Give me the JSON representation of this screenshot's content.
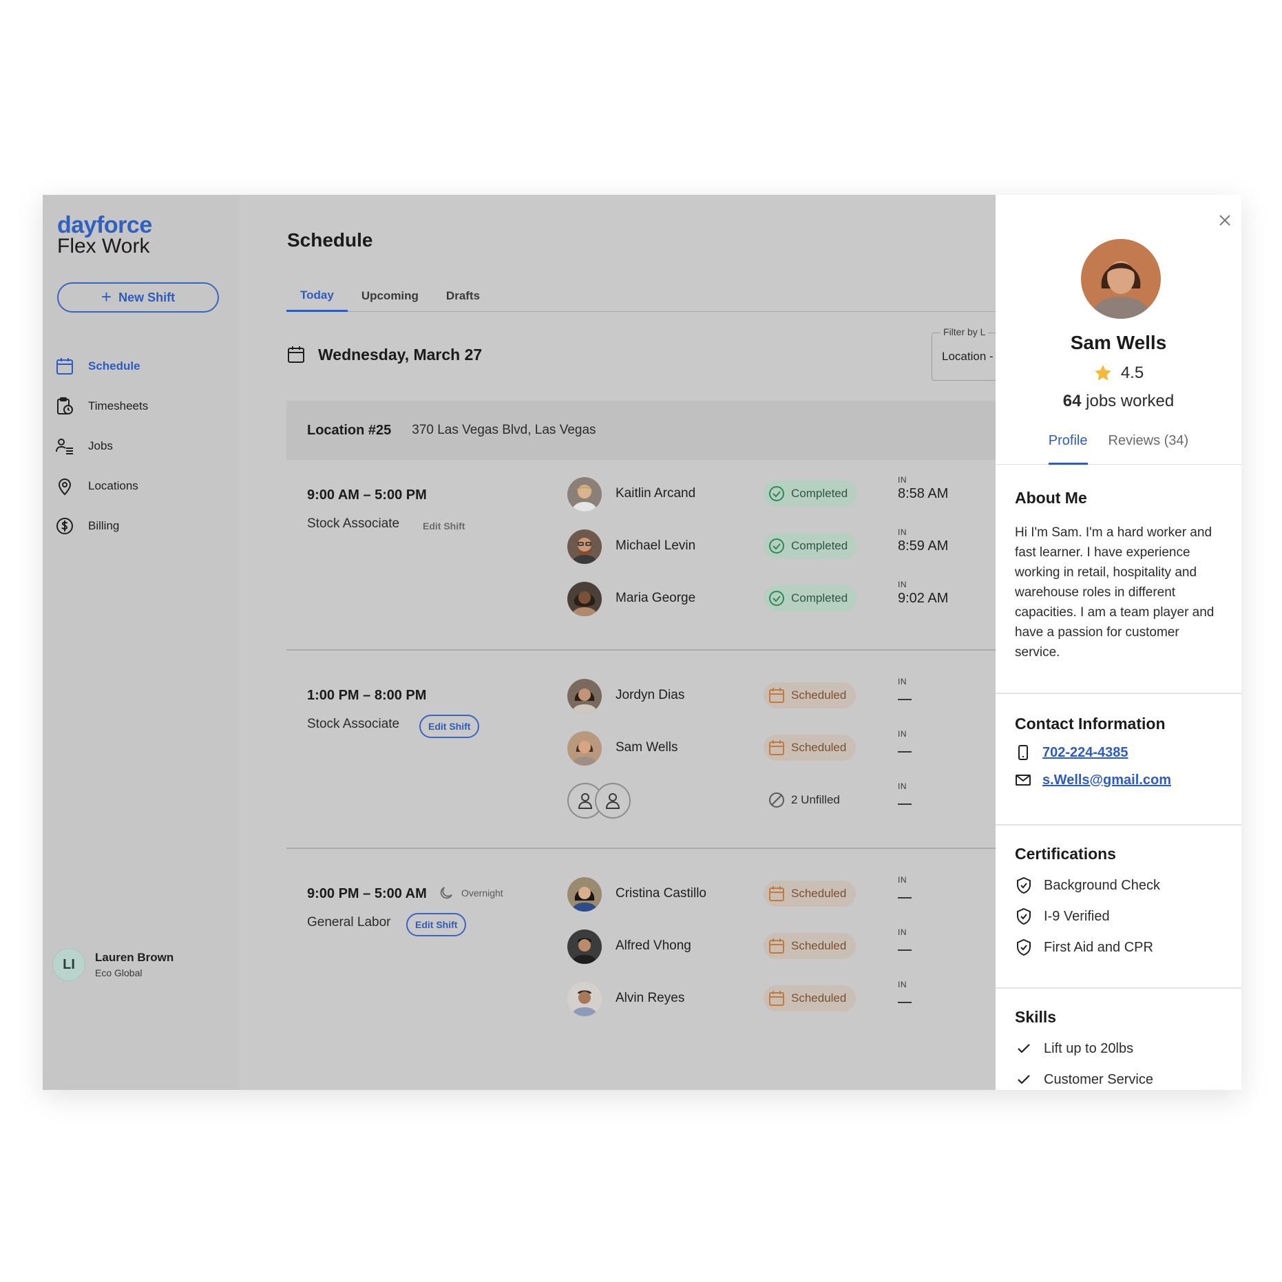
{
  "brand": {
    "name_top": "dayforce",
    "name_bottom": "Flex Work"
  },
  "sidebar": {
    "new_shift_label": "New Shift",
    "items": [
      {
        "label": "Schedule",
        "icon": "calendar-icon",
        "active": true
      },
      {
        "label": "Timesheets",
        "icon": "timesheet-icon"
      },
      {
        "label": "Jobs",
        "icon": "jobs-icon"
      },
      {
        "label": "Locations",
        "icon": "location-pin-icon"
      },
      {
        "label": "Billing",
        "icon": "dollar-icon"
      }
    ],
    "user": {
      "initials": "LI",
      "name": "Lauren Brown",
      "company": "Eco Global"
    }
  },
  "main": {
    "title": "Schedule",
    "tabs": [
      "Today",
      "Upcoming",
      "Drafts"
    ],
    "active_tab": "Today",
    "date": "Wednesday, March 27",
    "filter": {
      "label": "Filter by L",
      "value": "Location -"
    },
    "location": {
      "name": "Location #25",
      "address": "370 Las Vegas Blvd, Las Vegas"
    },
    "shifts": [
      {
        "time": "9:00 AM – 5:00 PM",
        "role": "Stock Associate",
        "edit_label": "Edit Shift",
        "workers": [
          {
            "name": "Kaitlin Arcand",
            "status": "Completed",
            "in_label": "IN",
            "in_time": "8:58 AM"
          },
          {
            "name": "Michael Levin",
            "status": "Completed",
            "in_label": "IN",
            "in_time": "8:59 AM"
          },
          {
            "name": "Maria George",
            "status": "Completed",
            "in_label": "IN",
            "in_time": "9:02 AM"
          }
        ]
      },
      {
        "time": "1:00 PM – 8:00 PM",
        "role": "Stock Associate",
        "edit_label": "Edit Shift",
        "workers": [
          {
            "name": "Jordyn Dias",
            "status": "Scheduled",
            "in_label": "IN"
          },
          {
            "name": "Sam Wells",
            "status": "Scheduled",
            "in_label": "IN"
          }
        ],
        "unfilled": {
          "label": "2 Unfilled",
          "in_label": "IN"
        }
      },
      {
        "time": "9:00 PM – 5:00 AM",
        "overnight_label": "Overnight",
        "role": "General Labor",
        "edit_label": "Edit Shift",
        "workers": [
          {
            "name": "Cristina Castillo",
            "status": "Scheduled",
            "in_label": "IN"
          },
          {
            "name": "Alfred Vhong",
            "status": "Scheduled",
            "in_label": "IN"
          },
          {
            "name": "Alvin Reyes",
            "status": "Scheduled",
            "in_label": "IN"
          }
        ]
      }
    ]
  },
  "panel": {
    "name": "Sam Wells",
    "rating": "4.5",
    "jobs_count": "64",
    "jobs_label": "jobs worked",
    "tabs": [
      "Profile",
      "Reviews (34)"
    ],
    "active_tab": "Profile",
    "about": {
      "title": "About Me",
      "text": "Hi I'm Sam. I'm a hard worker and fast learner. I have experience working in retail, hospitality and warehouse roles in different capacities. I am a team player and have a passion for customer service."
    },
    "contact": {
      "title": "Contact Information",
      "phone": "702-224-4385",
      "email": "s.Wells@gmail.com"
    },
    "certifications": {
      "title": "Certifications",
      "items": [
        "Background Check",
        "I-9 Verified",
        "First Aid and CPR"
      ]
    },
    "skills": {
      "title": "Skills",
      "items": [
        "Lift up to 20lbs",
        "Customer Service"
      ]
    }
  },
  "colors": {
    "accent": "#2f5bbf",
    "overlay": "#c9c9c9",
    "completed_bg": "#b6cfc1",
    "scheduled_bg": "#c9bfb4",
    "star": "#f2b93b"
  }
}
